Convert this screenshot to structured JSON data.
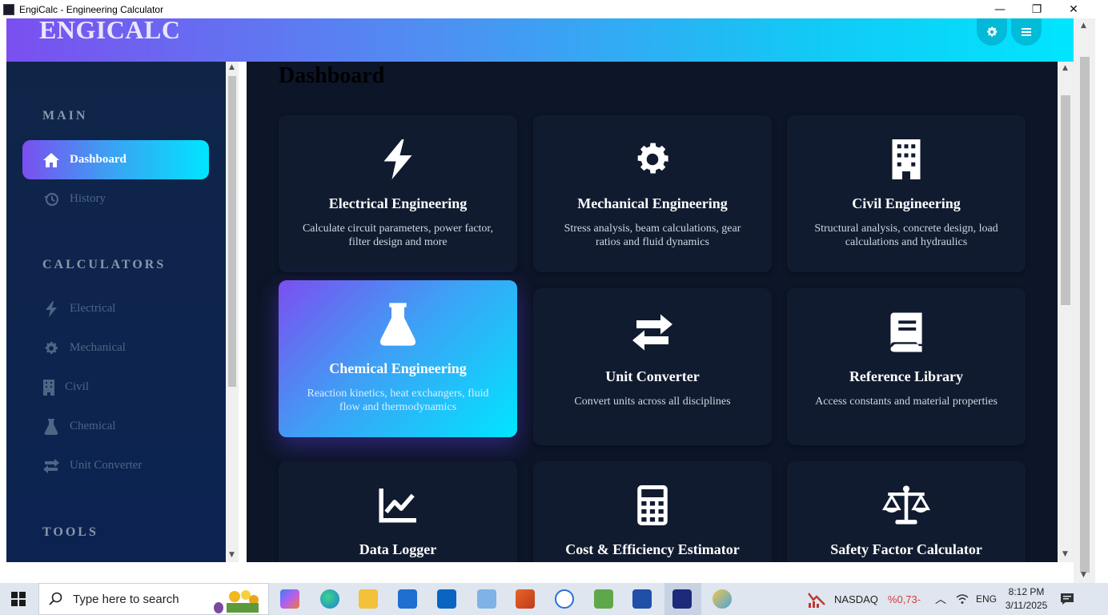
{
  "window": {
    "title": "EngiCalc - Engineering Calculator",
    "minimize": "—",
    "restore": "❐",
    "close": "✕"
  },
  "header": {
    "logo": "ENGICALC",
    "theme_icon": "gear-icon",
    "menu_icon": "menu-icon"
  },
  "sidebar": {
    "sections": [
      {
        "title": "MAIN"
      },
      {
        "title": "CALCULATORS"
      },
      {
        "title": "TOOLS"
      }
    ],
    "items": [
      {
        "label": "Dashboard",
        "icon": "home-icon",
        "active": true
      },
      {
        "label": "History",
        "icon": "history-icon"
      },
      {
        "label": "Electrical",
        "icon": "bolt-icon"
      },
      {
        "label": "Mechanical",
        "icon": "gear-icon"
      },
      {
        "label": "Civil",
        "icon": "building-icon"
      },
      {
        "label": "Chemical",
        "icon": "flask-icon"
      },
      {
        "label": "Unit Converter",
        "icon": "exchange-icon"
      }
    ]
  },
  "main": {
    "title": "Dashboard",
    "cards": [
      {
        "title": "Electrical Engineering",
        "desc": "Calculate circuit parameters, power factor, filter design and more",
        "icon": "bolt-icon"
      },
      {
        "title": "Mechanical Engineering",
        "desc": "Stress analysis, beam calculations, gear ratios and fluid dynamics",
        "icon": "gear-icon"
      },
      {
        "title": "Civil Engineering",
        "desc": "Structural analysis, concrete design, load calculations and hydraulics",
        "icon": "building-icon"
      },
      {
        "title": "Chemical Engineering",
        "desc": "Reaction kinetics, heat exchangers, fluid flow and thermodynamics",
        "icon": "flask-icon",
        "active": true
      },
      {
        "title": "Unit Converter",
        "desc": "Convert units across all disciplines",
        "icon": "exchange-icon"
      },
      {
        "title": "Reference Library",
        "desc": "Access constants and material properties",
        "icon": "book-icon"
      },
      {
        "title": "Data Logger",
        "desc": "",
        "icon": "chart-line-icon"
      },
      {
        "title": "Cost & Efficiency Estimator",
        "desc": "",
        "icon": "calculator-icon"
      },
      {
        "title": "Safety Factor Calculator",
        "desc": "",
        "icon": "balance-scale-icon"
      }
    ]
  },
  "taskbar": {
    "search_placeholder": "Type here to search",
    "stock_name": "NASDAQ",
    "stock_change": "%0,73-",
    "language": "ENG",
    "time": "8:12 PM",
    "date": "3/11/2025"
  },
  "colors": {
    "accent_start": "#7b4ff0",
    "accent_end": "#00e5ff",
    "main_bg": "#0d1528",
    "card_bg": "#111b30",
    "sidebar_bg": "#0f2548",
    "stock_negative": "#d83b3b"
  }
}
